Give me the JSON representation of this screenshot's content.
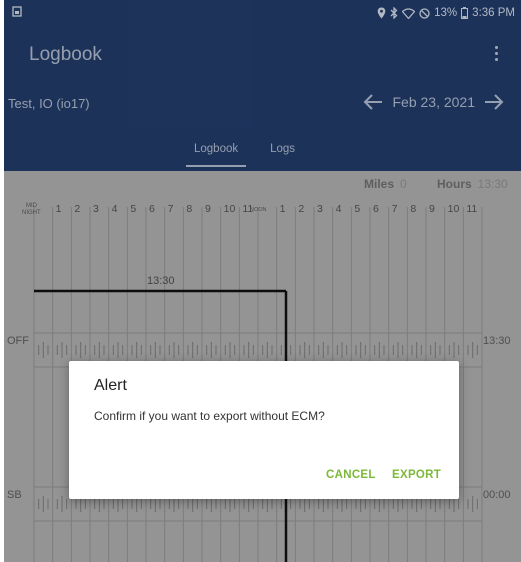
{
  "status": {
    "battery": "13%",
    "time": "3:36 PM"
  },
  "appbar": {
    "title": "Logbook",
    "driver": "Test, IO (io17)",
    "date": "Feb 23, 2021",
    "tabs": [
      "Logbook",
      "Logs"
    ],
    "active_tab": "Logbook"
  },
  "grid": {
    "miles_label": "Miles",
    "miles_value": "0",
    "hours_label": "Hours",
    "hours_value": "13:30",
    "hour_labels": [
      "MID NIGHT",
      "1",
      "2",
      "3",
      "4",
      "5",
      "6",
      "7",
      "8",
      "9",
      "10",
      "11",
      "NOON",
      "1",
      "2",
      "3",
      "4",
      "5",
      "6",
      "7",
      "8",
      "9",
      "10",
      "11"
    ],
    "rows": [
      {
        "label": "OFF",
        "total": "13:30"
      },
      {
        "label": "SB",
        "total": "00:00"
      }
    ],
    "segment_label": "13:30",
    "off_duty_end_hour": 13.5
  },
  "dialog": {
    "title": "Alert",
    "message": "Confirm if you want to export without ECM?",
    "cancel_label": "CANCEL",
    "export_label": "EXPORT"
  },
  "colors": {
    "appbar": "#213a66",
    "accent": "#7db83a"
  }
}
